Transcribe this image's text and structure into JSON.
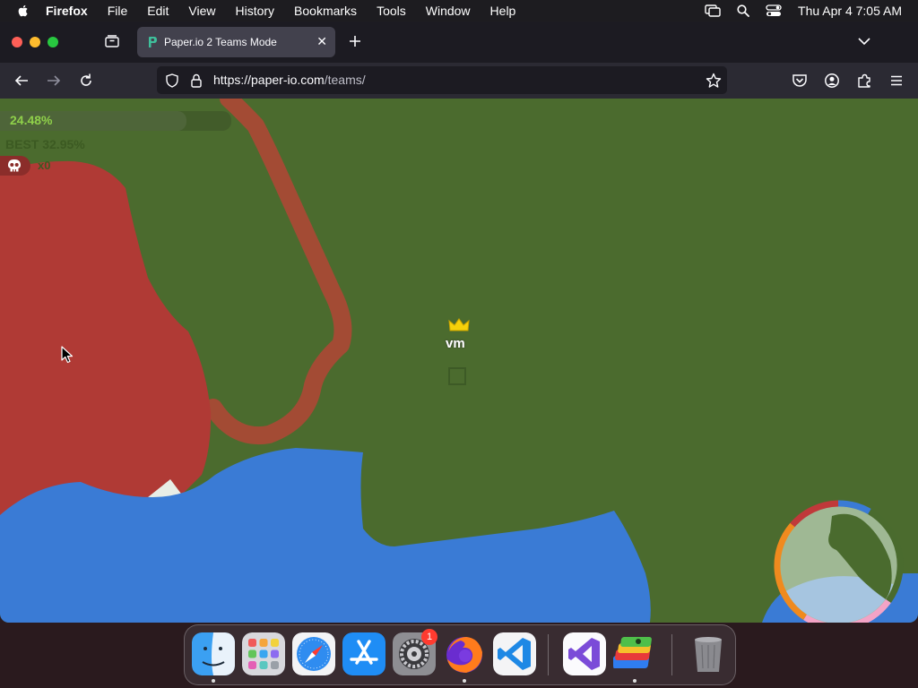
{
  "menubar": {
    "app_name": "Firefox",
    "items": [
      "File",
      "Edit",
      "View",
      "History",
      "Bookmarks",
      "Tools",
      "Window",
      "Help"
    ],
    "clock": "Thu Apr 4  7:05 AM"
  },
  "browser": {
    "tab_title": "Paper.io 2 Teams Mode",
    "url_host": "https://paper-io.com",
    "url_path": "/teams/"
  },
  "game": {
    "score_percent": "24.48%",
    "score_fraction": 0.2448,
    "best_label": "BEST 32.95%",
    "kills": "x0",
    "player_name": "vm",
    "colors": {
      "field": "#4b6b2e",
      "red_team": "#b03a35",
      "blue_team": "#3a7bd5",
      "trail": "#a84a35"
    }
  },
  "dock": {
    "apps": [
      "Finder",
      "Launchpad",
      "Safari",
      "App Store",
      "System Settings",
      "Firefox",
      "Visual Studio Code",
      "Visual Studio",
      "BlueStacks",
      "Trash"
    ],
    "settings_badge": "1"
  }
}
